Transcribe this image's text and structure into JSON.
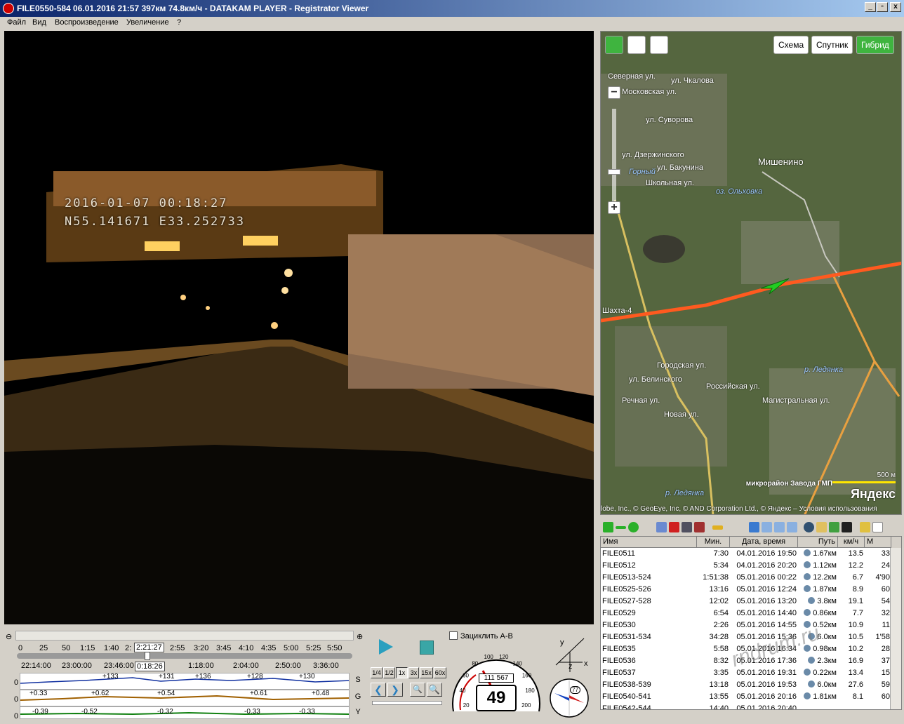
{
  "window": {
    "title": "FILE0550-584    06.01.2016 21:57    397км    74.8км/ч  -  DATAKAM PLAYER - Registrator Viewer",
    "buttons": [
      "_",
      "▫",
      "x"
    ]
  },
  "menu": [
    "Файл",
    "Вид",
    "Воспроизведение",
    "Увеличение",
    "?"
  ],
  "video": {
    "osd_datetime": "2016-01-07   00:18:27",
    "osd_coords": "N55.141671   E33.252733"
  },
  "map": {
    "types": [
      "Схема",
      "Спутник",
      "Гибрид"
    ],
    "active_type": "Гибрид",
    "labels": {
      "severnaya": "Северная ул.",
      "moskovskaya": "Московская ул.",
      "chkalova": "ул. Чкалова",
      "suvorova": "ул. Суворова",
      "dzerzhinskogo": "ул. Дзержинского",
      "bakunina": "ул. Бакунина",
      "shkolnaya": "Школьная ул.",
      "gorny": "Горный",
      "mishenino": "Мишенино",
      "olkhovka": "оз. Ольховка",
      "shakhta": "Шахта-4",
      "gorodskaya": "Городская ул.",
      "belinskogo": "ул. Белинского",
      "rechnaya": "Речная ул.",
      "novaya": "Новая ул.",
      "rossiyskaya": "Российская ул.",
      "magistralnaya": "Магистральная ул.",
      "ledyanka": "р. Ледянка",
      "ledyanka2": "р. Ледянка",
      "district": "микрорайон Завода ГМП",
      "scale": "500 м",
      "yandex": "Яндекс",
      "copyright": "lobe, Inc., © GeoEye, Inc, © AND Corporation Ltd., © Яндекс – Условия использования"
    },
    "colors": {
      "route": "#ff5a1f",
      "road": "#e8a040",
      "arrow": "#22cc22",
      "accent": "#3fb43f"
    }
  },
  "filelist": {
    "columns": [
      "Имя",
      "Мин.",
      "Дата, время",
      "Путь",
      "км/ч",
      "М"
    ],
    "rows": [
      [
        "FILE0511",
        "7:30",
        "04.01.2016 19:50",
        "1.67км",
        "13.5",
        "33"
      ],
      [
        "FILE0512",
        "5:34",
        "04.01.2016 20:20",
        "1.12км",
        "12.2",
        "24"
      ],
      [
        "FILE0513-524",
        "1:51:38",
        "05.01.2016 00:22",
        "12.2км",
        "6.7",
        "4'90"
      ],
      [
        "FILE0525-526",
        "13:16",
        "05.01.2016 12:24",
        "1.87км",
        "8.9",
        "60"
      ],
      [
        "FILE0527-528",
        "12:02",
        "05.01.2016 13:20",
        "3.8км",
        "19.1",
        "54"
      ],
      [
        "FILE0529",
        "6:54",
        "05.01.2016 14:40",
        "0.86км",
        "7.7",
        "32"
      ],
      [
        "FILE0530",
        "2:26",
        "05.01.2016 14:55",
        "0.52км",
        "10.9",
        "11"
      ],
      [
        "FILE0531-534",
        "34:28",
        "05.01.2016 15:36",
        "6.0км",
        "10.5",
        "1'58"
      ],
      [
        "FILE0535",
        "5:58",
        "05.01.2016 16:34",
        "0.98км",
        "10.2",
        "28"
      ],
      [
        "FILE0536",
        "8:32",
        "05.01.2016 17:36",
        "2.3км",
        "16.9",
        "37"
      ],
      [
        "FILE0537",
        "3:35",
        "05.01.2016 19:31",
        "0.22км",
        "13.4",
        "15"
      ],
      [
        "FILE0538-539",
        "13:18",
        "05.01.2016 19:53",
        "6.0км",
        "27.6",
        "59"
      ],
      [
        "FILE0540-541",
        "13:55",
        "05.01.2016 20:16",
        "1.81км",
        "8.1",
        "60"
      ],
      [
        "FILE0542-544",
        "14:40",
        "05.01.2016 20:40",
        "",
        "",
        ""
      ]
    ]
  },
  "timeline": {
    "ticks_top": [
      "0",
      "25",
      "50",
      "1:15",
      "1:40",
      "2:",
      "2:55",
      "3:20",
      "3:45",
      "4:10",
      "4:35",
      "5:00",
      "5:25",
      "5:50"
    ],
    "current_marker": "2:21:27",
    "ticks_clock": [
      "22:14:00",
      "23:00:00",
      "23:46:00",
      "0:18:26",
      "1:18:00",
      "2:04:00",
      "2:50:00",
      "3:36:00"
    ],
    "graphs": [
      {
        "axis": "S",
        "zero": "0",
        "labels": [
          "133",
          "131",
          "136",
          "128",
          "130"
        ]
      },
      {
        "axis": "G",
        "zero": "0",
        "labels": [
          "0.33",
          "0.62",
          "0.54",
          "0.61",
          "0.48"
        ]
      },
      {
        "axis": "Y",
        "zero": "0",
        "labels": [
          "0.39",
          "0.52",
          "0.32",
          "0.33",
          "0.33"
        ]
      }
    ]
  },
  "controls": {
    "speeds": [
      "1/4",
      "1/2",
      "1x",
      "3x",
      "15x",
      "60x"
    ],
    "active_speed": "1x",
    "loop_label": "Зациклить A-B"
  },
  "gauge": {
    "speed": "49",
    "odometer": "111 567",
    "scale": [
      "20",
      "40",
      "60",
      "80",
      "100",
      "120",
      "140",
      "160",
      "180",
      "200"
    ]
  },
  "compass": {
    "heading_label": "77"
  },
  "axes": {
    "x": "x",
    "y": "y",
    "z": "z"
  },
  "watermark": "rndrum.ru"
}
